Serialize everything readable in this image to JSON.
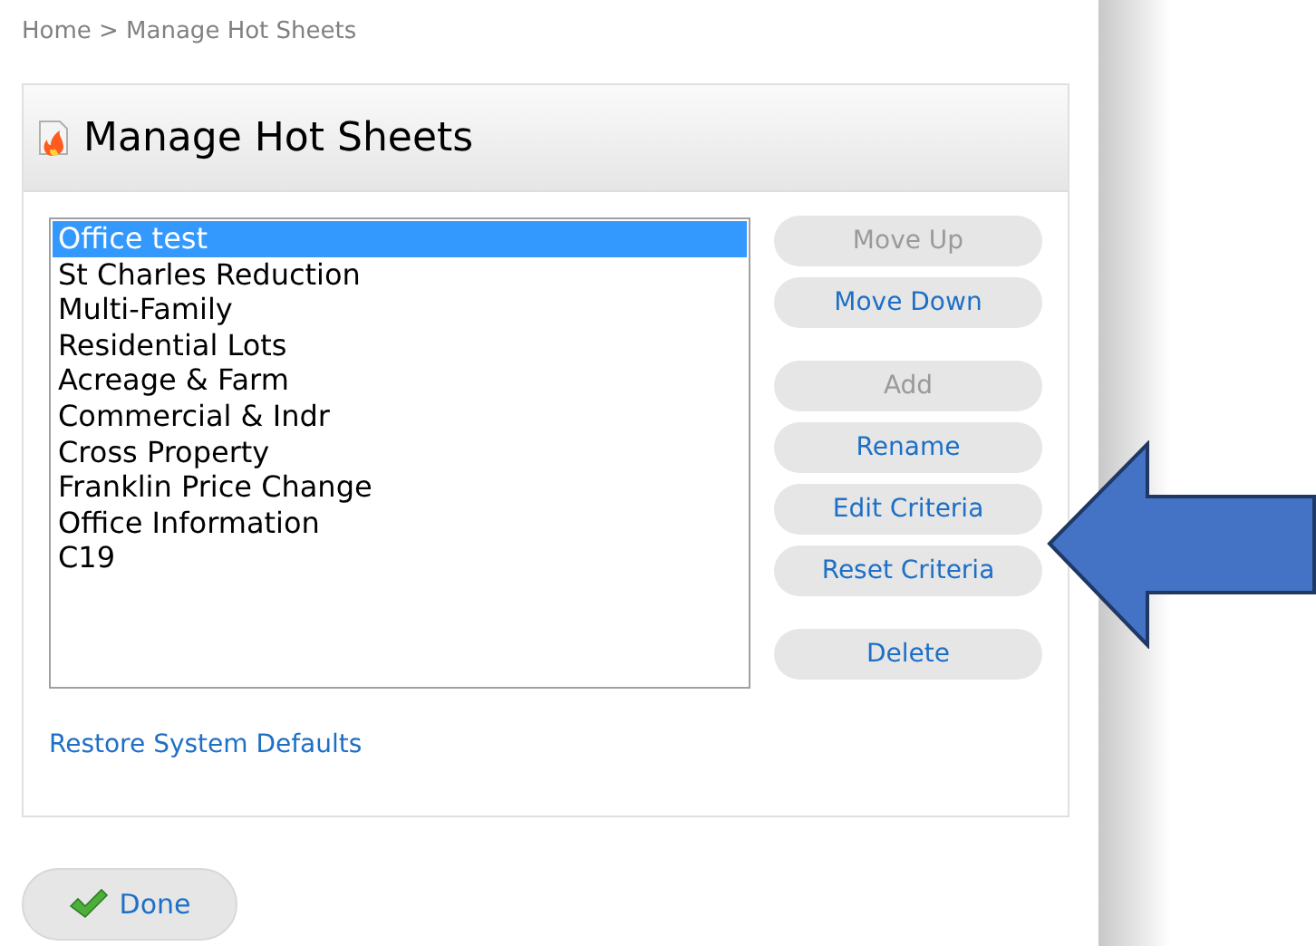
{
  "breadcrumb": "Home > Manage Hot Sheets",
  "panel": {
    "title": "Manage Hot Sheets"
  },
  "list": [
    {
      "label": "Office test",
      "selected": true
    },
    {
      "label": "St Charles Reduction",
      "selected": false
    },
    {
      "label": "Multi-Family",
      "selected": false
    },
    {
      "label": "Residential Lots",
      "selected": false
    },
    {
      "label": "Acreage & Farm",
      "selected": false
    },
    {
      "label": "Commercial & Indr",
      "selected": false
    },
    {
      "label": "Cross Property",
      "selected": false
    },
    {
      "label": "Franklin Price Change",
      "selected": false
    },
    {
      "label": "Office Information",
      "selected": false
    },
    {
      "label": "C19",
      "selected": false
    }
  ],
  "button_groups": [
    [
      {
        "label": "Move Up",
        "disabled": true
      },
      {
        "label": "Move Down",
        "disabled": false
      }
    ],
    [
      {
        "label": "Add",
        "disabled": true
      },
      {
        "label": "Rename",
        "disabled": false
      },
      {
        "label": "Edit Criteria",
        "disabled": false
      },
      {
        "label": "Reset Criteria",
        "disabled": false
      }
    ],
    [
      {
        "label": "Delete",
        "disabled": false
      }
    ]
  ],
  "restore_link": "Restore System Defaults",
  "done_button": "Done"
}
